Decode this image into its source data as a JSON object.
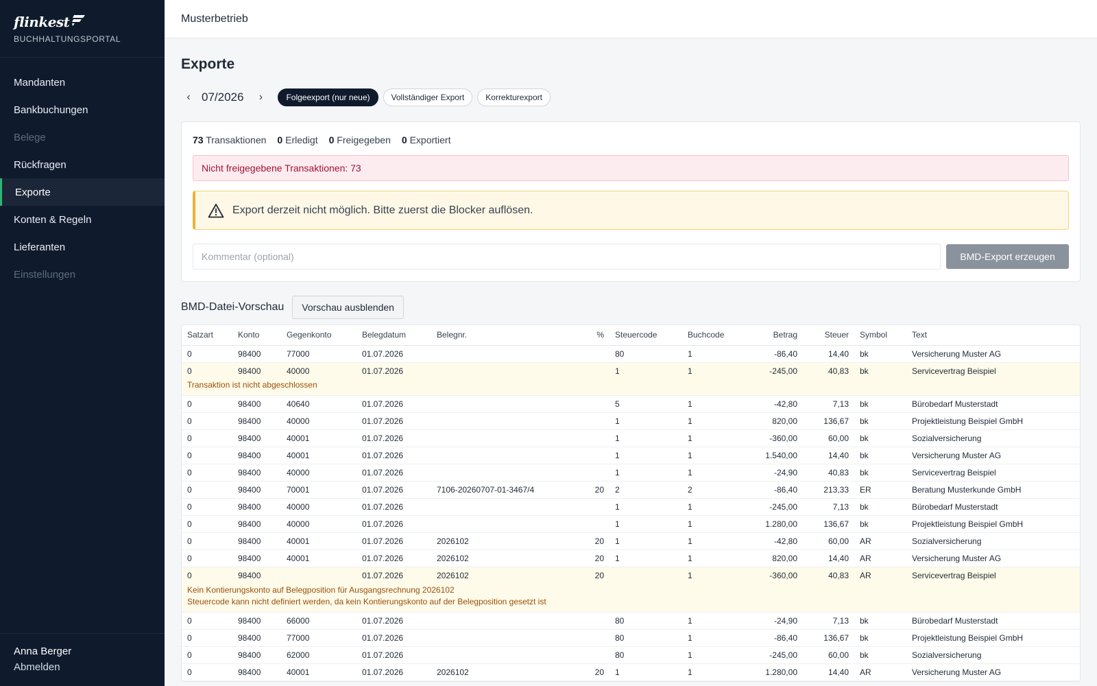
{
  "brand": {
    "logo": "flinkest",
    "subtitle": "BUCHHALTUNGSPORTAL"
  },
  "nav": [
    {
      "label": "Mandanten",
      "state": "normal"
    },
    {
      "label": "Bankbuchungen",
      "state": "normal"
    },
    {
      "label": "Belege",
      "state": "disabled"
    },
    {
      "label": "Rückfragen",
      "state": "normal"
    },
    {
      "label": "Exporte",
      "state": "active"
    },
    {
      "label": "Konten & Regeln",
      "state": "normal"
    },
    {
      "label": "Lieferanten",
      "state": "normal"
    },
    {
      "label": "Einstellungen",
      "state": "disabled"
    }
  ],
  "user": {
    "name": "Anna Berger",
    "logout": "Abmelden"
  },
  "topbar": {
    "title": "Musterbetrieb"
  },
  "page": {
    "title": "Exporte",
    "period": "07/2026",
    "prev": "‹",
    "next": "›",
    "modes": [
      "Folgeexport (nur neue)",
      "Vollständiger Export",
      "Korrekturexport"
    ],
    "active_mode": 0
  },
  "stats": [
    {
      "value": "73",
      "label": "Transaktionen"
    },
    {
      "value": "0",
      "label": "Erledigt"
    },
    {
      "value": "0",
      "label": "Freigegeben"
    },
    {
      "value": "0",
      "label": "Exportiert"
    }
  ],
  "alerts": {
    "unreleased": "Nicht freigegebene Transaktionen: 73",
    "blocked": "Export derzeit nicht möglich. Bitte zuerst die Blocker auflösen."
  },
  "comment": {
    "placeholder": "Kommentar (optional)",
    "value": ""
  },
  "export_button": "BMD-Export erzeugen",
  "preview": {
    "title": "BMD-Datei-Vorschau",
    "toggle": "Vorschau ausblenden"
  },
  "table": {
    "columns": [
      "Satzart",
      "Konto",
      "Gegenkonto",
      "Belegdatum",
      "Belegnr.",
      "%",
      "Steuercode",
      "Buchcode",
      "Betrag",
      "Steuer",
      "Symbol",
      "Text"
    ],
    "rows": [
      {
        "cells": [
          "0",
          "98400",
          "77000",
          "01.07.2026",
          "",
          "",
          "80",
          "1",
          "-86,40",
          "14,40",
          "bk",
          "Versicherung Muster AG"
        ]
      },
      {
        "cells": [
          "0",
          "98400",
          "40000",
          "01.07.2026",
          "",
          "",
          "1",
          "1",
          "-245,00",
          "40,83",
          "bk",
          "Servicevertrag Beispiel"
        ],
        "warnings": [
          "Transaktion ist nicht abgeschlossen"
        ]
      },
      {
        "cells": [
          "0",
          "98400",
          "40640",
          "01.07.2026",
          "",
          "",
          "5",
          "1",
          "-42,80",
          "7,13",
          "bk",
          "Bürobedarf Musterstadt"
        ]
      },
      {
        "cells": [
          "0",
          "98400",
          "40000",
          "01.07.2026",
          "",
          "",
          "1",
          "1",
          "820,00",
          "136,67",
          "bk",
          "Projektleistung Beispiel GmbH"
        ]
      },
      {
        "cells": [
          "0",
          "98400",
          "40001",
          "01.07.2026",
          "",
          "",
          "1",
          "1",
          "-360,00",
          "60,00",
          "bk",
          "Sozialversicherung"
        ]
      },
      {
        "cells": [
          "0",
          "98400",
          "40001",
          "01.07.2026",
          "",
          "",
          "1",
          "1",
          "1.540,00",
          "14,40",
          "bk",
          "Versicherung Muster AG"
        ]
      },
      {
        "cells": [
          "0",
          "98400",
          "40000",
          "01.07.2026",
          "",
          "",
          "1",
          "1",
          "-24,90",
          "40,83",
          "bk",
          "Servicevertrag Beispiel"
        ]
      },
      {
        "cells": [
          "0",
          "98400",
          "70001",
          "01.07.2026",
          "7106-20260707-01-3467/4",
          "20",
          "2",
          "2",
          "-86,40",
          "213,33",
          "ER",
          "Beratung Musterkunde GmbH"
        ]
      },
      {
        "cells": [
          "0",
          "98400",
          "40000",
          "01.07.2026",
          "",
          "",
          "1",
          "1",
          "-245,00",
          "7,13",
          "bk",
          "Bürobedarf Musterstadt"
        ]
      },
      {
        "cells": [
          "0",
          "98400",
          "40000",
          "01.07.2026",
          "",
          "",
          "1",
          "1",
          "1.280,00",
          "136,67",
          "bk",
          "Projektleistung Beispiel GmbH"
        ]
      },
      {
        "cells": [
          "0",
          "98400",
          "40001",
          "01.07.2026",
          "2026102",
          "20",
          "1",
          "1",
          "-42,80",
          "60,00",
          "AR",
          "Sozialversicherung"
        ]
      },
      {
        "cells": [
          "0",
          "98400",
          "40001",
          "01.07.2026",
          "2026102",
          "20",
          "1",
          "1",
          "820,00",
          "14,40",
          "AR",
          "Versicherung Muster AG"
        ]
      },
      {
        "cells": [
          "0",
          "98400",
          "",
          "01.07.2026",
          "2026102",
          "20",
          "",
          "1",
          "-360,00",
          "40,83",
          "AR",
          "Servicevertrag Beispiel"
        ],
        "warnings": [
          "Kein Kontierungskonto auf Belegposition für Ausgangsrechnung 2026102",
          "Steuercode kann nicht definiert werden, da kein Kontierungskonto auf der Belegposition gesetzt ist"
        ]
      },
      {
        "cells": [
          "0",
          "98400",
          "66000",
          "01.07.2026",
          "",
          "",
          "80",
          "1",
          "-24,90",
          "7,13",
          "bk",
          "Bürobedarf Musterstadt"
        ]
      },
      {
        "cells": [
          "0",
          "98400",
          "77000",
          "01.07.2026",
          "",
          "",
          "80",
          "1",
          "-86,40",
          "136,67",
          "bk",
          "Projektleistung Beispiel GmbH"
        ]
      },
      {
        "cells": [
          "0",
          "98400",
          "62000",
          "01.07.2026",
          "",
          "",
          "80",
          "1",
          "-245,00",
          "60,00",
          "bk",
          "Sozialversicherung"
        ]
      },
      {
        "cells": [
          "0",
          "98400",
          "40001",
          "01.07.2026",
          "2026102",
          "20",
          "1",
          "1",
          "1.280,00",
          "14,40",
          "AR",
          "Versicherung Muster AG"
        ]
      }
    ]
  },
  "colors": {
    "sidebar": "#0f1b2d",
    "accent": "#2bb673",
    "error_text": "#9f1239",
    "warning_text": "#9a4f08",
    "warning_row": "#fffbea"
  }
}
